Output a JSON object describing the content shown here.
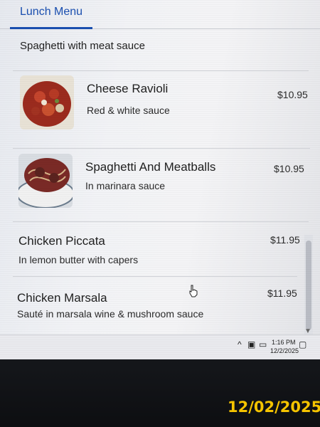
{
  "tab": {
    "label": "Lunch Menu"
  },
  "partial_item": {
    "name": "Spaghetti with meat sauce"
  },
  "items": [
    {
      "name": "Cheese Ravioli",
      "description": "Red & white sauce",
      "price": "$10.95",
      "image": "ravioli-photo"
    },
    {
      "name": "Spaghetti And Meatballs",
      "description": "In marinara sauce",
      "price": "$10.95",
      "image": "spaghetti-photo"
    },
    {
      "name": "Chicken Piccata",
      "description": "In lemon butter with capers",
      "price": "$11.95"
    },
    {
      "name": "Chicken Marsala",
      "description": "Sauté in marsala wine & mushroom sauce",
      "price": "$11.95"
    }
  ],
  "taskbar": {
    "time": "1:16 PM",
    "date": "12/2/2025"
  },
  "photo_date_stamp": "12/02/2025",
  "colors": {
    "accent": "#1a4fb0",
    "stamp": "#f5c400"
  }
}
